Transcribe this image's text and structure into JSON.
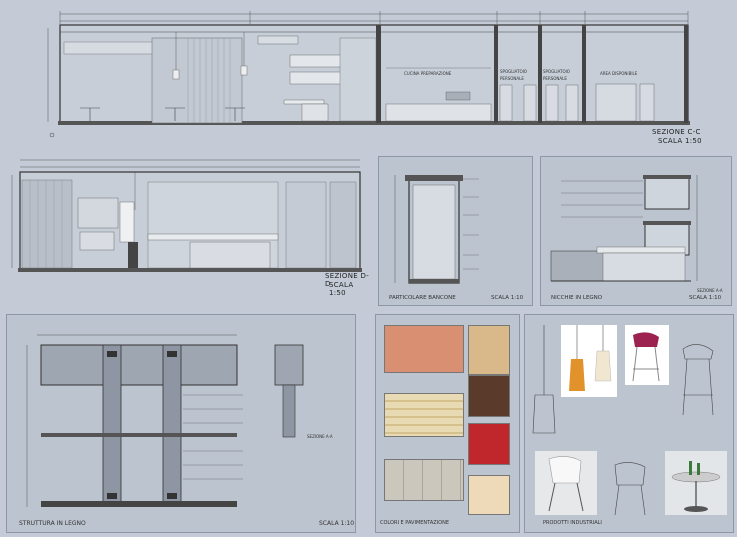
{
  "sheets": {
    "top_section": {
      "label_1": "SEZIONE C-C",
      "label_2": "SCALA 1:50"
    },
    "mid_section": {
      "label_1": "SEZIONE D-D",
      "label_2": "SCALA 1:50"
    },
    "particolare": {
      "title": "PARTICOLARE BANCONE",
      "scale": "SCALA 1:10"
    },
    "nicchie": {
      "title": "NICCHIE IN LEGNO",
      "scale": "SCALA 1:10"
    },
    "struttura": {
      "title": "STRUTTURA IN LEGNO",
      "scale": "SCALA 1:10"
    },
    "colori": {
      "title": "COLORI E PAVIMENTAZIONE"
    },
    "prodotti": {
      "title": "PRODOTTI INDUSTRIALI"
    }
  },
  "top_room_labels": [
    "CUCINA PREPARAZIONE",
    "SPOGLIATOIO PERSONALE",
    "SPOGLIATOIO PERSONALE",
    "AREA DISPONIBILE"
  ],
  "detail_labels": [
    "SEZIONE A-A",
    "SEZIONE A-A"
  ],
  "colors": {
    "background": "#c4cbd6",
    "panel": "#bcc4cf",
    "tile_terracotta": "#d98f72",
    "tile_wood_light": "#d9b98a",
    "tile_wood_dark": "#5a3a2a",
    "tile_red": "#c0272d",
    "tile_cream": "#eed9b8",
    "tile_stripes": "#e2d2a8",
    "tile_grey": "#c9c5bb",
    "lamp_orange": "#e1922a",
    "chair_magenta": "#9e2250"
  },
  "icons": [
    "pendant-lamp-orange-icon",
    "pendant-lamp-white-icon",
    "bar-stool-magenta-icon",
    "bar-stool-wire-icon",
    "chair-white-icon",
    "chair-metal-icon",
    "table-round-icon"
  ]
}
